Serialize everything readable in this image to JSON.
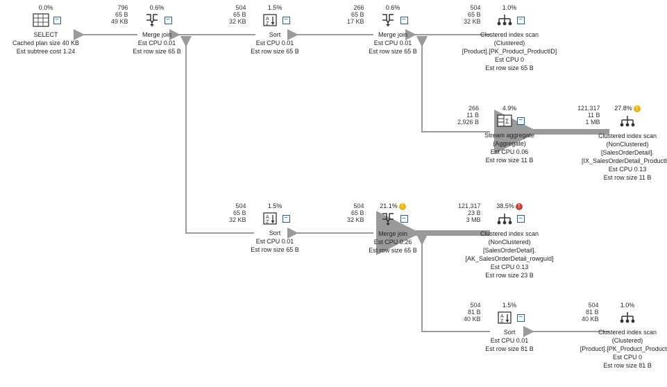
{
  "toggle_glyph": "−",
  "nodes": {
    "select": {
      "cost": "0.0%",
      "title": "SELECT",
      "lines": [
        "Cached plan size  40 KB",
        "Est subtree cost  1.24"
      ]
    },
    "mj1": {
      "cost": "0.6%",
      "title": "Merge join",
      "lines": [
        "Est CPU  0.01",
        "Est row size  65 B"
      ],
      "estat": [
        "796",
        "65 B",
        "49 KB"
      ]
    },
    "sort1": {
      "cost": "1.5%",
      "title": "Sort",
      "lines": [
        "Est CPU  0.01",
        "Est row size  65 B"
      ],
      "estat": [
        "504",
        "65 B",
        "32 KB"
      ]
    },
    "mj2": {
      "cost": "0.6%",
      "title": "Merge join",
      "lines": [
        "Est CPU  0.01",
        "Est row size  65 B"
      ],
      "estat": [
        "266",
        "65 B",
        "17 KB"
      ]
    },
    "cix_prod1": {
      "cost": "1.0%",
      "title": "Clustered index scan",
      "lines": [
        "(Clustered)",
        "[Product].[PK_Product_ProductID]",
        "Est CPU  0",
        "Est row size  65 B"
      ],
      "estat": [
        "504",
        "65 B",
        "32 KB"
      ]
    },
    "sagg": {
      "cost": "4.9%",
      "title": "Stream aggregate",
      "lines": [
        "(Aggregate)",
        "Est CPU  0.06",
        "Est row size  11 B"
      ],
      "estat": [
        "266",
        "11 B",
        "2,926 B"
      ]
    },
    "cix_sod_pid": {
      "cost": "27.8%",
      "badge": "warn",
      "title": "Clustered index scan",
      "lines": [
        "(NonClustered)",
        "[SalesOrderDetail].",
        "[IX_SalesOrderDetail_ProductID]",
        "Est CPU  0.13",
        "Est row size  11 B"
      ],
      "estat": [
        "121,317",
        "11 B",
        "1 MB"
      ]
    },
    "sort2": {
      "cost": "1.5%",
      "title": "Sort",
      "lines": [
        "Est CPU  0.01",
        "Est row size  65 B"
      ],
      "estat": [
        "504",
        "65 B",
        "32 KB"
      ]
    },
    "mj3": {
      "cost": "21.1%",
      "badge": "warn",
      "title": "Merge join",
      "lines": [
        "Est CPU  0.26",
        "Est row size  65 B"
      ],
      "estat": [
        "504",
        "65 B",
        "32 KB"
      ]
    },
    "cix_sod_rg": {
      "cost": "38.5%",
      "badge": "err",
      "title": "Clustered index scan",
      "lines": [
        "(NonClustered)",
        "[SalesOrderDetail].",
        "[AK_SalesOrderDetail_rowguid]",
        "Est CPU  0.13",
        "Est row size  23 B"
      ],
      "estat": [
        "121,317",
        "23 B",
        "3 MB"
      ]
    },
    "sort3": {
      "cost": "1.5%",
      "title": "Sort",
      "lines": [
        "Est CPU  0.01",
        "Est row size  81 B"
      ],
      "estat": [
        "504",
        "81 B",
        "40 KB"
      ]
    },
    "cix_prod2": {
      "cost": "1.0%",
      "title": "Clustered index scan",
      "lines": [
        "(Clustered)",
        "[Product].[PK_Product_ProductID]",
        "Est CPU  0",
        "Est row size  81 B"
      ],
      "estat": [
        "504",
        "81 B",
        "40 KB"
      ]
    }
  }
}
